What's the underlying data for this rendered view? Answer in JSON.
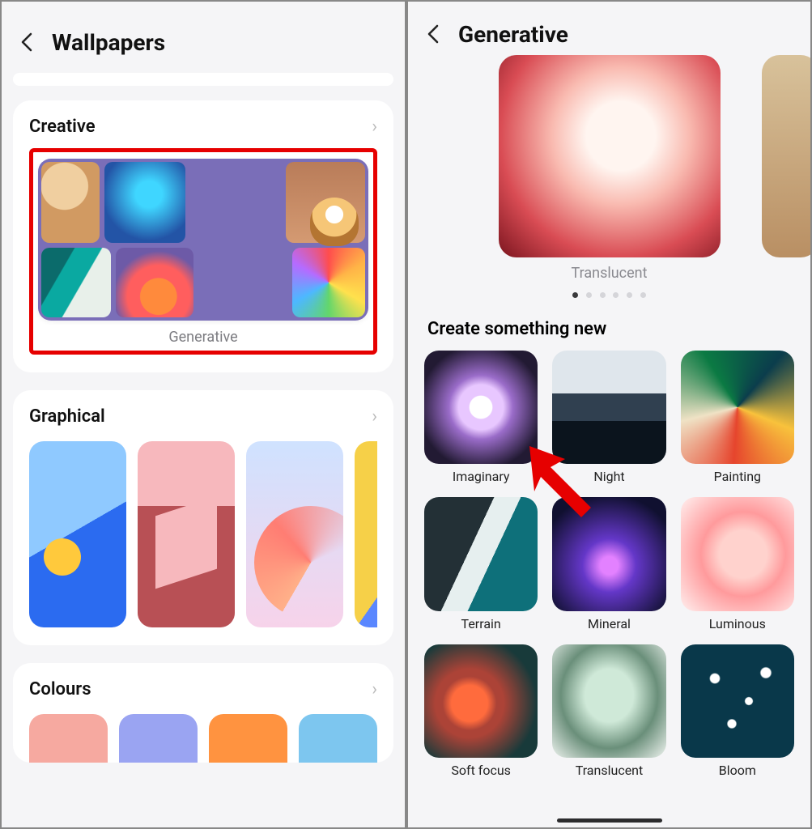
{
  "left": {
    "title": "Wallpapers",
    "sections": {
      "creative": {
        "label": "Creative",
        "item_caption": "Generative"
      },
      "graphical": {
        "label": "Graphical"
      },
      "colours": {
        "label": "Colours"
      }
    }
  },
  "right": {
    "title": "Generative",
    "hero_caption": "Translucent",
    "carousel": {
      "count": 6,
      "active": 0
    },
    "create_heading": "Create something new",
    "tiles": [
      "Imaginary",
      "Night",
      "Painting",
      "Terrain",
      "Mineral",
      "Luminous",
      "Soft focus",
      "Translucent",
      "Bloom"
    ]
  }
}
